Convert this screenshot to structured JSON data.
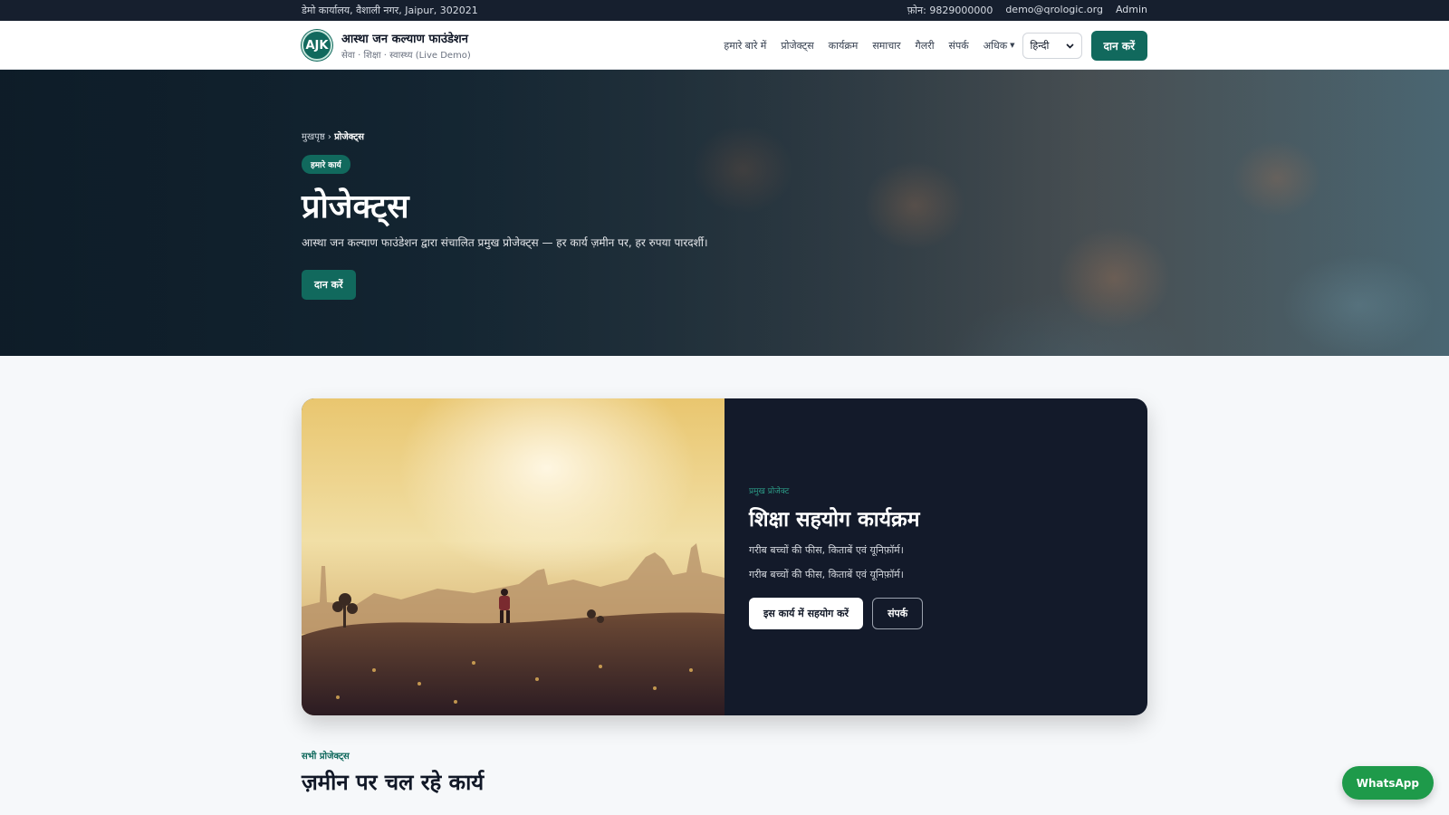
{
  "topbar": {
    "address": "डेमो कार्यालय, वैशाली नगर, Jaipur, 302021",
    "phone": "फ़ोन: 9829000000",
    "email": "demo@qrologic.org",
    "admin": "Admin"
  },
  "header": {
    "logo_text": "AJK",
    "org_name": "आस्था जन कल्याण फाउंडेशन",
    "tagline": "सेवा · शिक्षा · स्वास्थ्य (Live Demo)",
    "nav": [
      {
        "label": "हमारे बारे में"
      },
      {
        "label": "प्रोजेक्ट्स"
      },
      {
        "label": "कार्यक्रम"
      },
      {
        "label": "समाचार"
      },
      {
        "label": "गैलरी"
      },
      {
        "label": "संपर्क"
      }
    ],
    "more_label": "अधिक",
    "language": "हिन्दी",
    "donate_label": "दान करें"
  },
  "hero": {
    "breadcrumb_home": "मुखपृष्ठ",
    "breadcrumb_sep": "›",
    "breadcrumb_current": "प्रोजेक्ट्स",
    "tag": "हमारे कार्य",
    "title": "प्रोजेक्ट्स",
    "description": "आस्था जन कल्याण फाउंडेशन द्वारा संचालित प्रमुख प्रोजेक्ट्स — हर कार्य ज़मीन पर, हर रुपया पारदर्शी।",
    "donate_label": "दान करें"
  },
  "featured": {
    "kicker": "प्रमुख प्रोजेक्ट",
    "title": "शिक्षा सहयोग कार्यक्रम",
    "text1": "गरीब बच्चों की फीस, किताबें एवं यूनिफ़ॉर्म।",
    "text2": "गरीब बच्चों की फीस, किताबें एवं यूनिफ़ॉर्म।",
    "support_label": "इस कार्य में सहयोग करें",
    "contact_label": "संपर्क"
  },
  "all_projects": {
    "kicker": "सभी प्रोजेक्ट्स",
    "title": "ज़मीन पर चल रहे कार्य"
  },
  "whatsapp": {
    "label": "WhatsApp"
  }
}
